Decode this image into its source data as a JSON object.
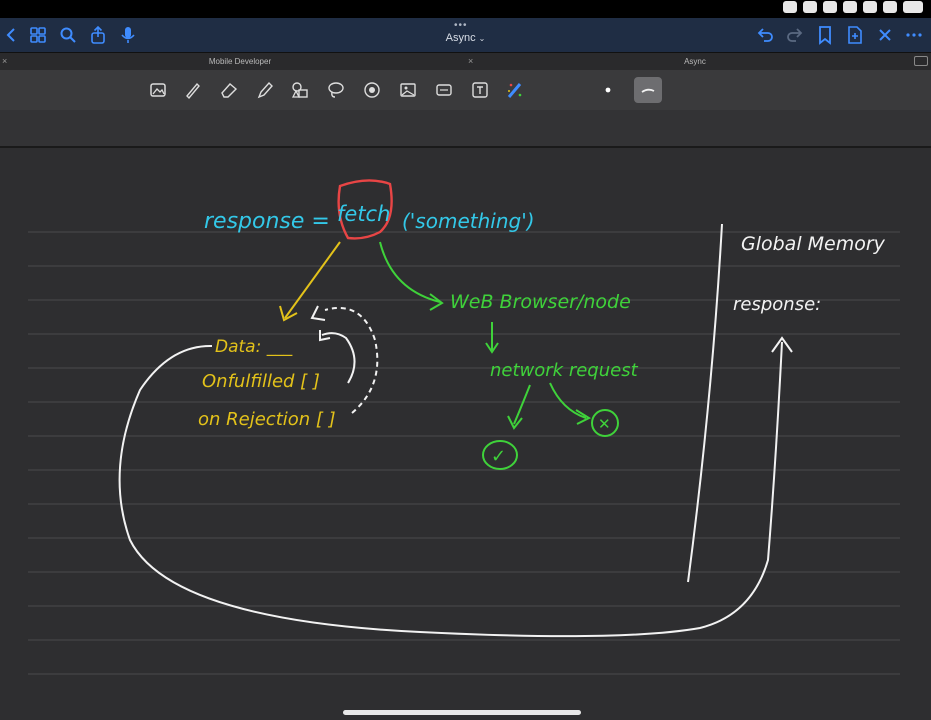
{
  "nav": {
    "document_title": "Async",
    "title_chevron": "⌄"
  },
  "tabs": [
    {
      "label": "Mobile Developer"
    },
    {
      "label": "Async"
    }
  ],
  "tab_close_glyph": "×",
  "toolbar": {
    "tools": [
      "image-icon",
      "pen-icon",
      "eraser-icon",
      "highlighter-icon",
      "shapes-icon",
      "lasso-icon",
      "laser-pointer-icon",
      "photo-icon",
      "sticker-icon",
      "text-icon",
      "element-icon"
    ],
    "active_color": "#ffffff"
  },
  "notes": {
    "code_left": "response = ",
    "code_fetch": "fetch",
    "code_args": "('something')",
    "promise_data": "Data: ___",
    "promise_onfulfilled": "Onfulfilled [ ]",
    "promise_onrejection": "on Rejection [ ]",
    "web_browser": "WeB Browser/node",
    "network_request": "network request",
    "success_mark": "✓",
    "failure_mark": "✕",
    "global_memory": "Global Memory",
    "response_var": "response:"
  },
  "colors": {
    "code_cyan": "#33c8e8",
    "fetch_red": "#e84545",
    "promise_yellow": "#e3c21a",
    "network_green": "#3fd23a",
    "ink_white": "#f2f2f2",
    "nav_accent": "#3f8cff",
    "nav_bg": "#1f2d44",
    "page_bg": "#2e2e30"
  }
}
